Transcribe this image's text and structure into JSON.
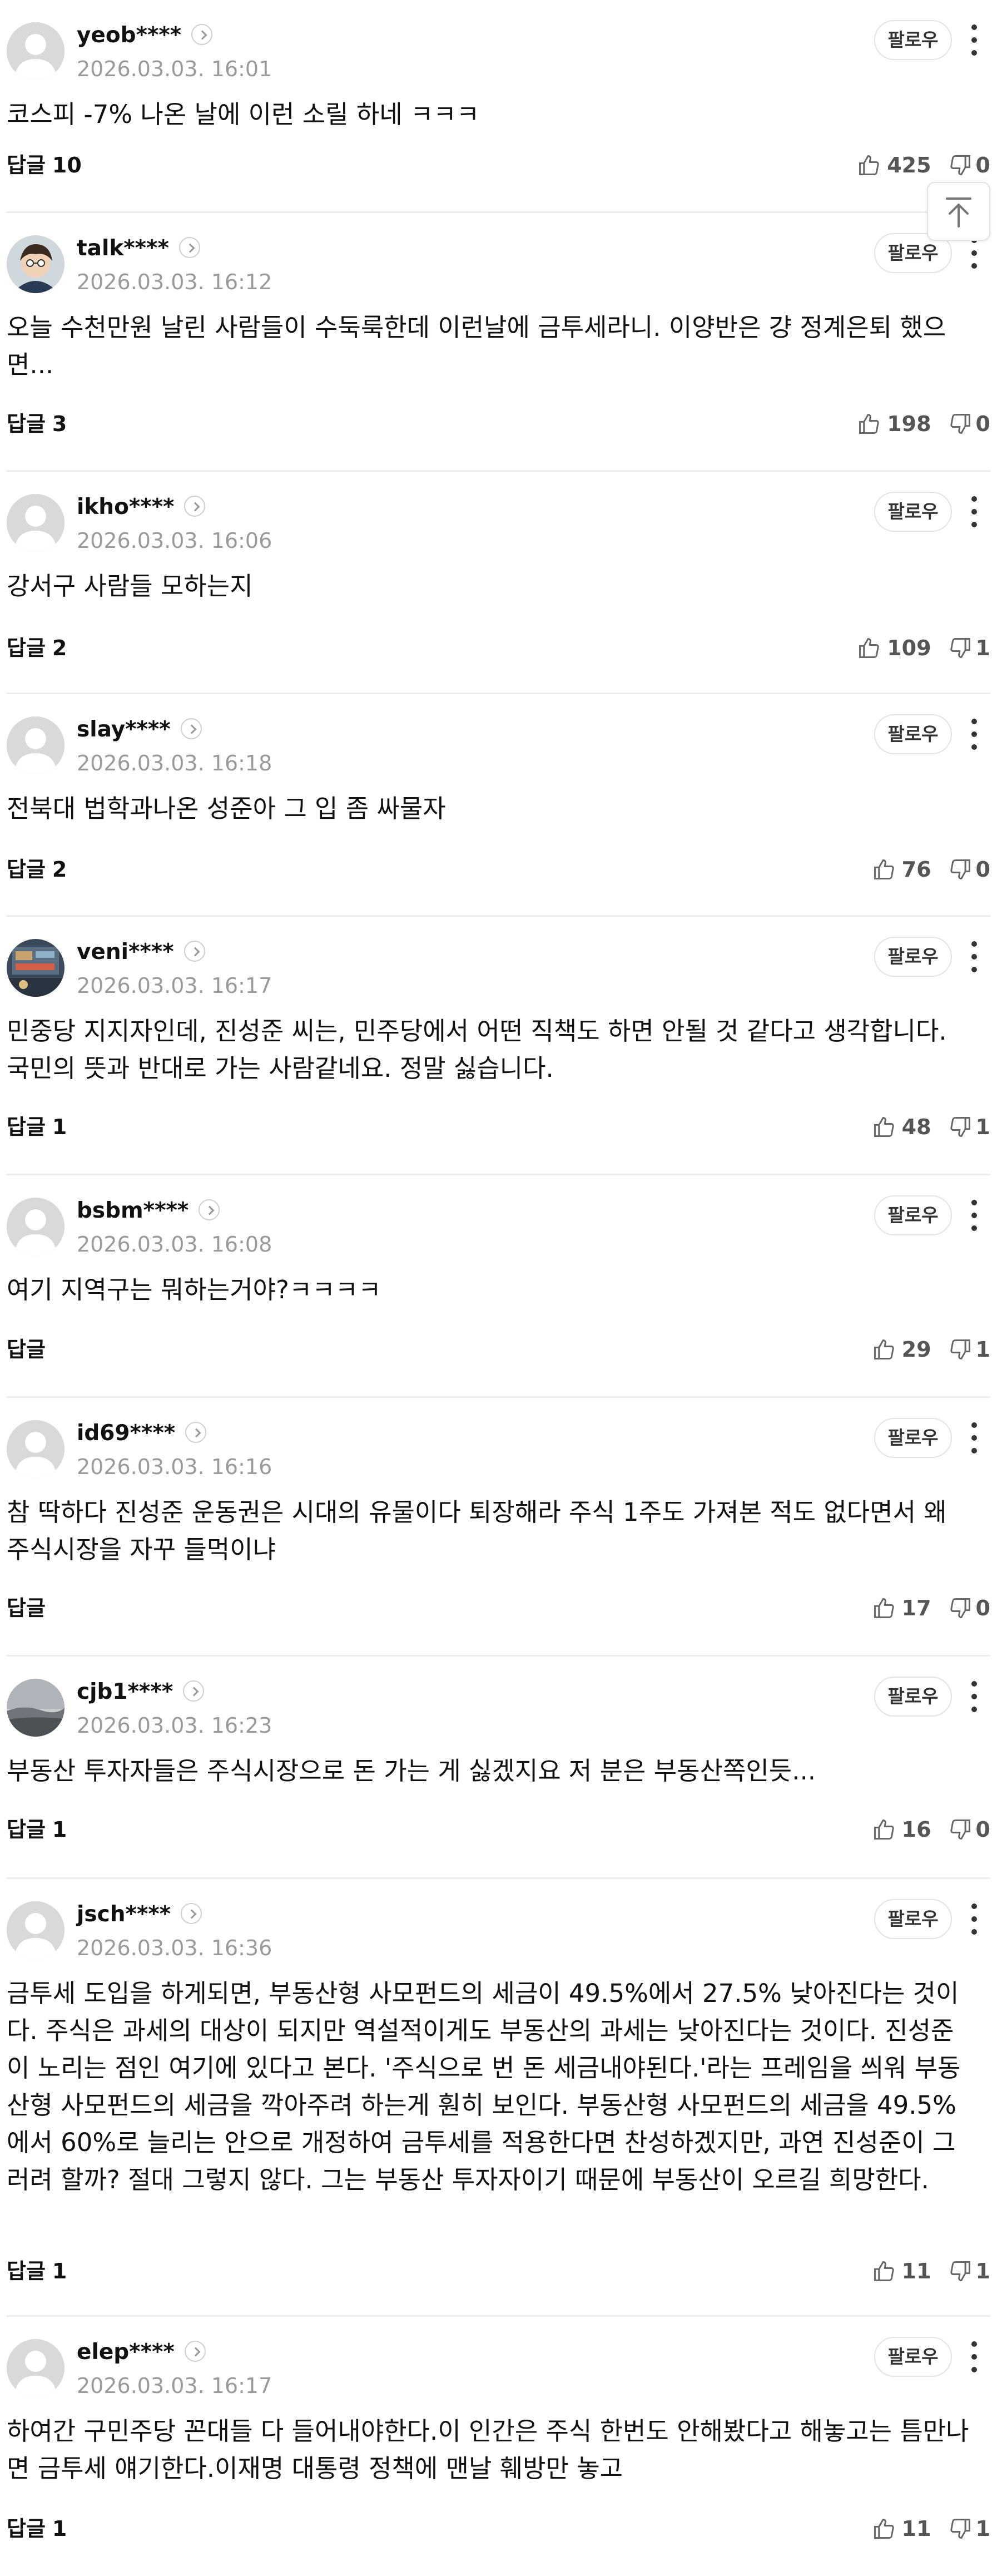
{
  "comments": [
    {
      "nick": "yeob****",
      "date": "2026.03.03. 16:01",
      "body": "코스피 -7% 나온 날에 이런 소릴 하네 ㅋㅋㅋ",
      "reply_label": "답글",
      "reply_count": "10",
      "likes": "425",
      "dislikes": "0",
      "avatar": "default"
    },
    {
      "nick": "talk****",
      "date": "2026.03.03. 16:12",
      "body": "오늘 수천만원 날린 사람들이 수둑룩한데 이런날에 금투세라니. 이양반은 걍 정계은퇴 했으면...",
      "reply_label": "답글",
      "reply_count": "3",
      "likes": "198",
      "dislikes": "0",
      "avatar": "character"
    },
    {
      "nick": "ikho****",
      "date": "2026.03.03. 16:06",
      "body": "강서구 사람들 모하는지",
      "reply_label": "답글",
      "reply_count": "2",
      "likes": "109",
      "dislikes": "1",
      "avatar": "default"
    },
    {
      "nick": "slay****",
      "date": "2026.03.03. 16:18",
      "body": "전북대 법학과나온 성준아 그 입 좀 싸물자",
      "reply_label": "답글",
      "reply_count": "2",
      "likes": "76",
      "dislikes": "0",
      "avatar": "default"
    },
    {
      "nick": "veni****",
      "date": "2026.03.03. 16:17",
      "body": "민중당 지지자인데, 진성준 씨는, 민주당에서 어떤 직책도 하면 안될 것 같다고 생각합니다. 국민의 뜻과 반대로 가는 사람같네요. 정말 싫습니다.",
      "reply_label": "답글",
      "reply_count": "1",
      "likes": "48",
      "dislikes": "1",
      "avatar": "photo"
    },
    {
      "nick": "bsbm****",
      "date": "2026.03.03. 16:08",
      "body": "여기 지역구는 뭐하는거야?ㅋㅋㅋㅋ",
      "reply_label": "답글",
      "reply_count": "",
      "likes": "29",
      "dislikes": "1",
      "avatar": "default"
    },
    {
      "nick": "id69****",
      "date": "2026.03.03. 16:16",
      "body": "참 딱하다 진성준 운동권은 시대의 유물이다 퇴장해라 주식 1주도 가져본 적도 없다면서 왜 주식시장을 자꾸 들먹이냐",
      "reply_label": "답글",
      "reply_count": "",
      "likes": "17",
      "dislikes": "0",
      "avatar": "default"
    },
    {
      "nick": "cjb1****",
      "date": "2026.03.03. 16:23",
      "body": "부동산 투자자들은 주식시장으로 돈 가는 게 싫겠지요 저 분은 부동산쪽인듯...",
      "reply_label": "답글",
      "reply_count": "1",
      "likes": "16",
      "dislikes": "0",
      "avatar": "landscape"
    },
    {
      "nick": "jsch****",
      "date": "2026.03.03. 16:36",
      "body": "금투세 도입을 하게되면, 부동산형 사모펀드의 세금이 49.5%에서 27.5% 낮아진다는 것이다. 주식은 과세의 대상이 되지만 역설적이게도 부동산의 과세는 낮아진다는 것이다. 진성준이 노리는 점인 여기에 있다고 본다. '주식으로 번 돈 세금내야된다.'라는 프레임을 씌워 부동산형 사모펀드의 세금을 깍아주려 하는게 훤히 보인다. 부동산형 사모펀드의 세금을 49.5%에서 60%로 늘리는 안으로 개정하여 금투세를 적용한다면 찬성하겠지만, 과연 진성준이 그러려 할까? 절대 그렇지 않다. 그는 부동산 투자자이기 때문에 부동산이 오르길 희망한다.",
      "reply_label": "답글",
      "reply_count": "1",
      "likes": "11",
      "dislikes": "1",
      "avatar": "default"
    },
    {
      "nick": "elep****",
      "date": "2026.03.03. 16:17",
      "body": "하여간 구민주당 꼰대들 다 들어내야한다.이 인간은 주식 한번도 안해봤다고 해놓고는 틈만나면 금투세 얘기한다.이재명 대통령 정책에 맨날 훼방만 놓고",
      "reply_label": "답글",
      "reply_count": "1",
      "likes": "11",
      "dislikes": "1",
      "avatar": "default"
    }
  ],
  "follow_label": "팔로우",
  "icons": {
    "like": "thumbs-up-icon",
    "dislike": "thumbs-down-icon",
    "more": "more-vertical-icon",
    "profile": "chevron-right-icon",
    "scroll_top": "arrow-up-to-top-icon"
  },
  "colors": {
    "text": "#111111",
    "meta": "#9a9a9a",
    "divider": "#ececec",
    "avatar_bg": "#d9d9d9"
  }
}
